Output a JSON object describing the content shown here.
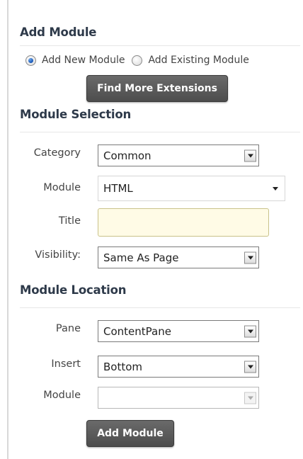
{
  "add_module": {
    "title": "Add Module",
    "radio_new_label": "Add New Module",
    "radio_existing_label": "Add Existing Module",
    "radio_selected": "new",
    "find_extensions_button": "Find More Extensions"
  },
  "module_selection": {
    "title": "Module Selection",
    "category_label": "Category",
    "category_value": "Common",
    "module_label": "Module",
    "module_value": "HTML",
    "title_label": "Title",
    "title_value": "",
    "visibility_label": "Visibility:",
    "visibility_value": "Same As Page"
  },
  "module_location": {
    "title": "Module Location",
    "pane_label": "Pane",
    "pane_value": "ContentPane",
    "insert_label": "Insert",
    "insert_value": "Bottom",
    "module_label": "Module",
    "module_value": "",
    "add_button": "Add Module"
  },
  "colors": {
    "title_text": "#2e3a4a",
    "button_bg": "#5a5a5a",
    "title_input_bg": "#fffbe6",
    "radio_selected": "#1f5fbf"
  }
}
